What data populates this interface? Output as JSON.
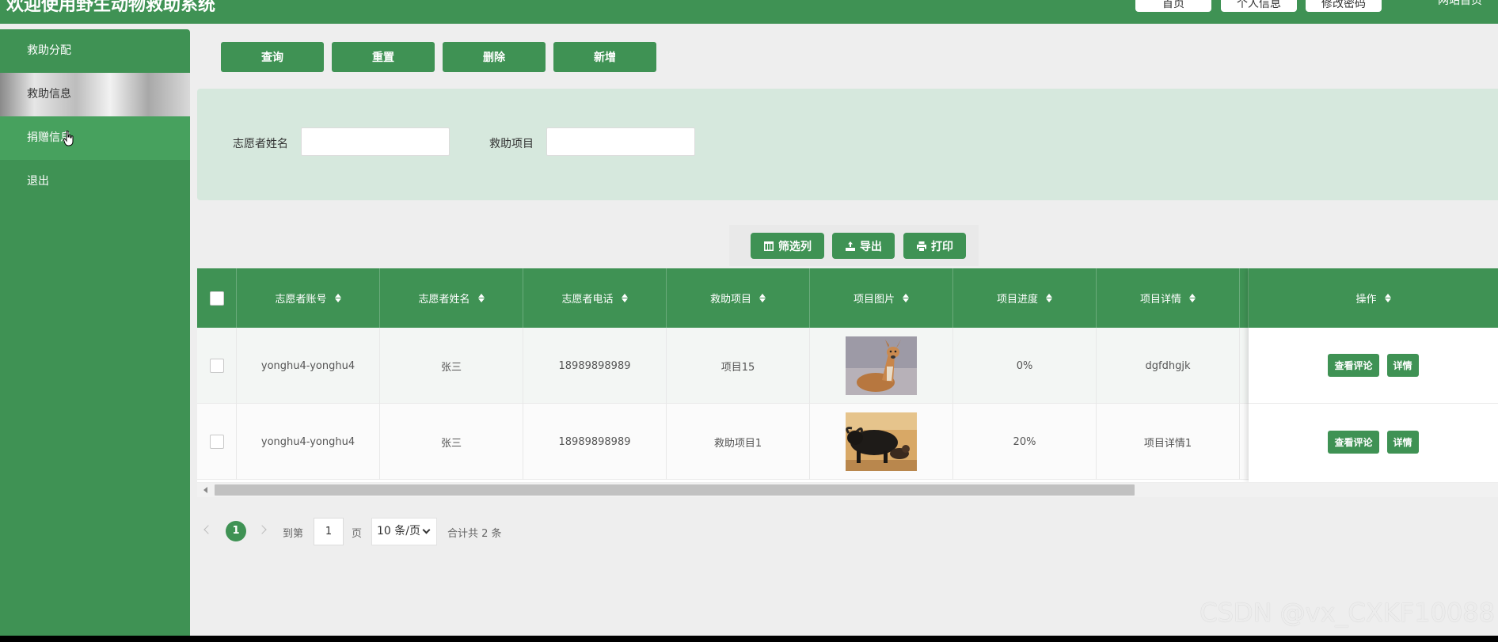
{
  "header": {
    "title": "欢迎使用野生动物救助系统",
    "nav_buttons": [
      "首页",
      "个人信息",
      "修改密码"
    ],
    "site_link": "网站首页"
  },
  "sidebar": {
    "items": [
      {
        "label": "救助分配"
      },
      {
        "label": "救助信息"
      },
      {
        "label": "捐赠信息"
      },
      {
        "label": "退出"
      }
    ]
  },
  "actions": {
    "query": "查询",
    "reset": "重置",
    "delete": "删除",
    "add": "新增"
  },
  "search": {
    "volunteer_name_label": "志愿者姓名",
    "volunteer_name_value": "",
    "project_label": "救助项目",
    "project_value": ""
  },
  "toolbar": {
    "filter_columns": "筛选列",
    "export": "导出",
    "print": "打印"
  },
  "table": {
    "columns": [
      "志愿者账号",
      "志愿者姓名",
      "志愿者电话",
      "救助项目",
      "项目图片",
      "项目进度",
      "项目详情",
      "操作"
    ],
    "rows": [
      {
        "account": "yonghu4-yonghu4",
        "name": "张三",
        "phone": "18989898989",
        "project": "项目15",
        "image": "deer-photo",
        "progress": "0%",
        "details": "dgfdhgjk"
      },
      {
        "account": "yonghu4-yonghu4",
        "name": "张三",
        "phone": "18989898989",
        "project": "救助项目1",
        "image": "buffalo-photo",
        "progress": "20%",
        "details": "项目详情1"
      }
    ],
    "op_buttons": {
      "comments": "查看评论",
      "detail": "详情"
    }
  },
  "pagination": {
    "current_page": "1",
    "goto_label": "到第",
    "page_input": "1",
    "page_unit": "页",
    "page_size": "10 条/页",
    "total": "合计共 2 条"
  },
  "watermark": "CSDN @vx_CXKF10088",
  "colors": {
    "primary_green": "#3f9254",
    "panel_green": "#d6e8dd",
    "background": "#eeeeee"
  }
}
